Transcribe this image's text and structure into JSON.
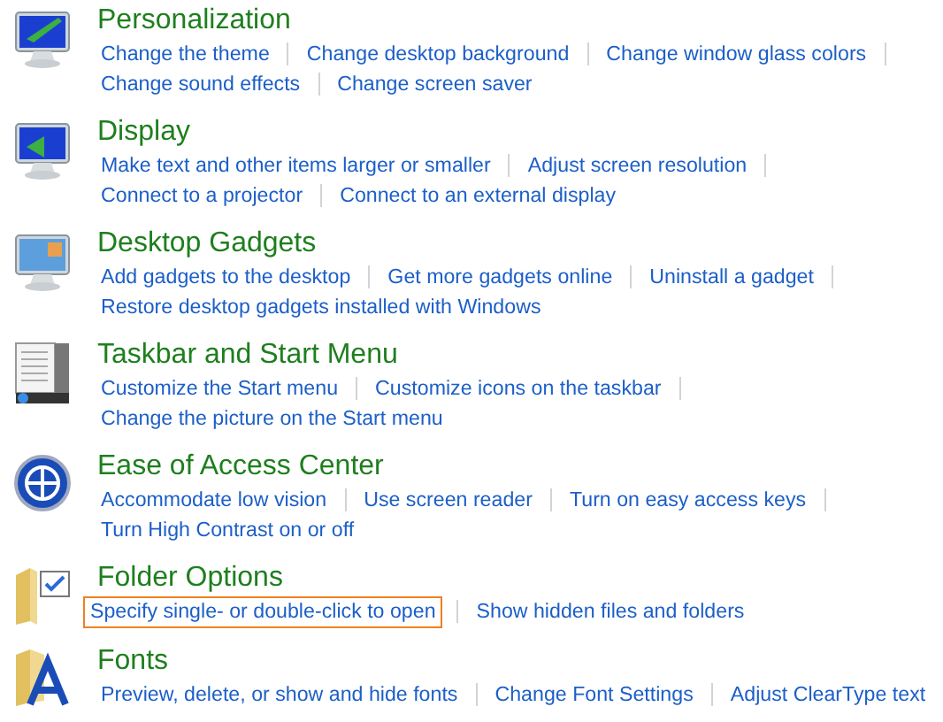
{
  "sections": [
    {
      "title": "Personalization",
      "kind": "monitor-paint",
      "lines": [
        [
          {
            "label": "Change the theme",
            "focused": false
          },
          {
            "label": "Change desktop background",
            "focused": false
          },
          {
            "label": "Change window glass colors",
            "focused": false
          }
        ],
        [
          {
            "label": "Change sound effects",
            "focused": false
          },
          {
            "label": "Change screen saver",
            "focused": false
          }
        ]
      ]
    },
    {
      "title": "Display",
      "kind": "monitor",
      "lines": [
        [
          {
            "label": "Make text and other items larger or smaller",
            "focused": false
          },
          {
            "label": "Adjust screen resolution",
            "focused": false
          }
        ],
        [
          {
            "label": "Connect to a projector",
            "focused": false
          },
          {
            "label": "Connect to an external display",
            "focused": false
          }
        ]
      ]
    },
    {
      "title": "Desktop Gadgets",
      "kind": "gadgets",
      "lines": [
        [
          {
            "label": "Add gadgets to the desktop",
            "focused": false
          },
          {
            "label": "Get more gadgets online",
            "focused": false
          },
          {
            "label": "Uninstall a gadget",
            "focused": false
          }
        ],
        [
          {
            "label": "Restore desktop gadgets installed with Windows",
            "focused": false
          }
        ]
      ]
    },
    {
      "title": "Taskbar and Start Menu",
      "kind": "taskbar",
      "lines": [
        [
          {
            "label": "Customize the Start menu",
            "focused": false
          },
          {
            "label": "Customize icons on the taskbar",
            "focused": false
          }
        ],
        [
          {
            "label": "Change the picture on the Start menu",
            "focused": false
          }
        ]
      ]
    },
    {
      "title": "Ease of Access Center",
      "kind": "ease",
      "lines": [
        [
          {
            "label": "Accommodate low vision",
            "focused": false
          },
          {
            "label": "Use screen reader",
            "focused": false
          },
          {
            "label": "Turn on easy access keys",
            "focused": false
          }
        ],
        [
          {
            "label": "Turn High Contrast on or off",
            "focused": false
          }
        ]
      ]
    },
    {
      "title": "Folder Options",
      "kind": "folder",
      "lines": [
        [
          {
            "label": "Specify single- or double-click to open",
            "focused": true
          },
          {
            "label": "Show hidden files and folders",
            "focused": false
          }
        ]
      ]
    },
    {
      "title": "Fonts",
      "kind": "fonts",
      "lines": [
        [
          {
            "label": "Preview, delete, or show and hide fonts",
            "focused": false
          },
          {
            "label": "Change Font Settings",
            "focused": false
          },
          {
            "label": "Adjust ClearType text",
            "focused": false
          }
        ]
      ]
    }
  ]
}
